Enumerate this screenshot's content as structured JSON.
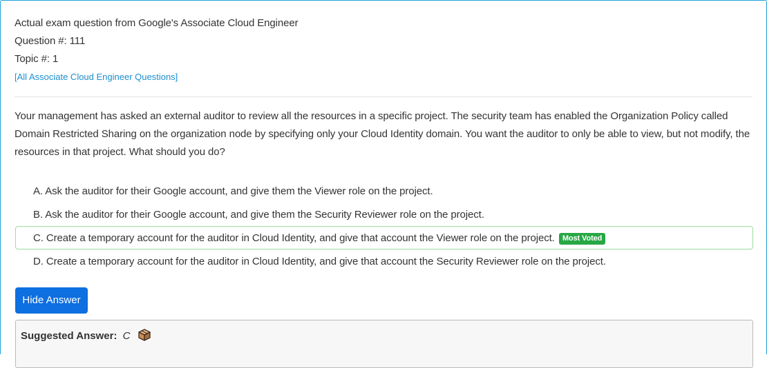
{
  "header": {
    "source_line": "Actual exam question from Google's Associate Cloud Engineer",
    "question_number": "Question #: 111",
    "topic": "Topic #: 1",
    "all_questions_link": "[All Associate Cloud Engineer Questions]"
  },
  "question": {
    "text": "Your management has asked an external auditor to review all the resources in a specific project. The security team has enabled the Organization Policy called Domain Restricted Sharing on the organization node by specifying only your Cloud Identity domain. You want the auditor to only be able to view, but not modify, the resources in that project. What should you do?"
  },
  "choices": [
    {
      "text": "A. Ask the auditor for their Google account, and give them the Viewer role on the project."
    },
    {
      "text": "B. Ask the auditor for their Google account, and give them the Security Reviewer role on the project."
    },
    {
      "text": "C. Create a temporary account for the auditor in Cloud Identity, and give that account the Viewer role on the project.",
      "badge": "Most Voted"
    },
    {
      "text": "D. Create a temporary account for the auditor in Cloud Identity, and give that account the Security Reviewer role on the project."
    }
  ],
  "hide_answer_button": "Hide Answer",
  "suggested_answer": {
    "label": "Suggested Answer:",
    "value": "C",
    "icon": "box-icon"
  },
  "colors": {
    "accent_border": "#1d9fd8",
    "link": "#1a8fd0",
    "button": "#0d6fe0",
    "badge": "#28a745",
    "voted_border": "#9edc9e"
  }
}
